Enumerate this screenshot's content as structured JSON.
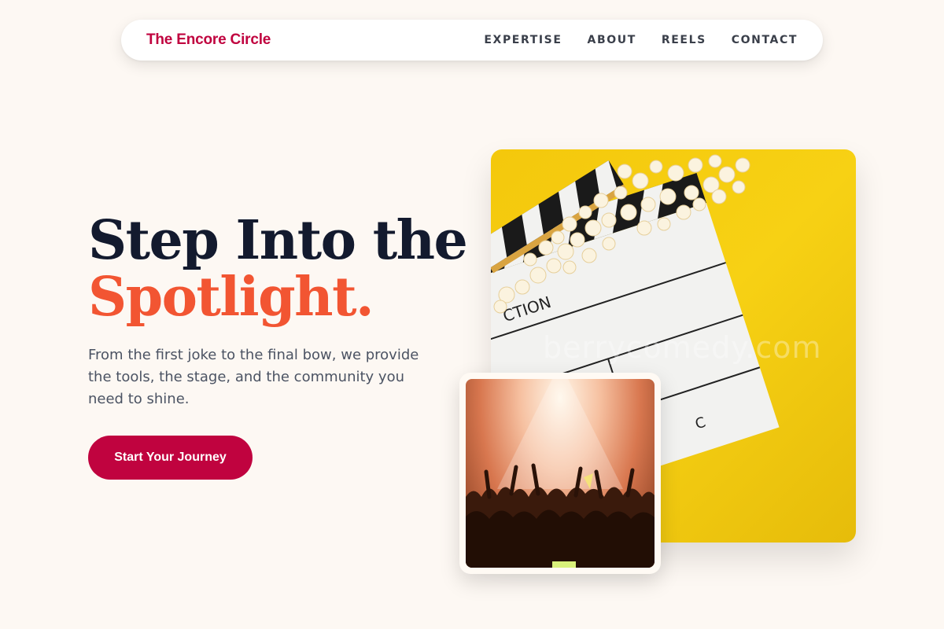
{
  "nav": {
    "brand": "The Encore Circle",
    "links": [
      "EXPERTISE",
      "ABOUT",
      "REELS",
      "CONTACT"
    ]
  },
  "hero": {
    "title_line1": "Step Into the",
    "title_line2": "Spotlight.",
    "description": "From the first joke to the final bow, we provide the tools, the stage, and the community you need to shine.",
    "cta_label": "Start Your Journey"
  },
  "images": {
    "main": {
      "subject": "clapperboard-with-popcorn",
      "slate_text_1": "CTION",
      "slate_text_2": "C",
      "watermark": "berrycomedy.com"
    },
    "secondary": {
      "subject": "concert-crowd"
    }
  },
  "colors": {
    "brand": "#c0033f",
    "accent": "#f25532",
    "heading": "#131a2e",
    "background": "#fdf8f3",
    "yellow": "#f4c80c"
  }
}
